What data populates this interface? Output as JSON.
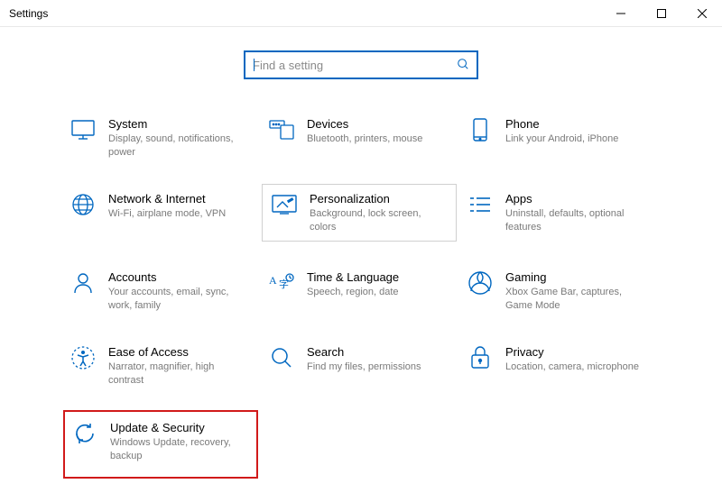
{
  "window": {
    "title": "Settings"
  },
  "search": {
    "placeholder": "Find a setting"
  },
  "tiles": {
    "system": {
      "title": "System",
      "desc": "Display, sound, notifications, power"
    },
    "devices": {
      "title": "Devices",
      "desc": "Bluetooth, printers, mouse"
    },
    "phone": {
      "title": "Phone",
      "desc": "Link your Android, iPhone"
    },
    "network": {
      "title": "Network & Internet",
      "desc": "Wi-Fi, airplane mode, VPN"
    },
    "personalize": {
      "title": "Personalization",
      "desc": "Background, lock screen, colors"
    },
    "apps": {
      "title": "Apps",
      "desc": "Uninstall, defaults, optional features"
    },
    "accounts": {
      "title": "Accounts",
      "desc": "Your accounts, email, sync, work, family"
    },
    "time": {
      "title": "Time & Language",
      "desc": "Speech, region, date"
    },
    "gaming": {
      "title": "Gaming",
      "desc": "Xbox Game Bar, captures, Game Mode"
    },
    "ease": {
      "title": "Ease of Access",
      "desc": "Narrator, magnifier, high contrast"
    },
    "searchTile": {
      "title": "Search",
      "desc": "Find my files, permissions"
    },
    "privacy": {
      "title": "Privacy",
      "desc": "Location, camera, microphone"
    },
    "update": {
      "title": "Update & Security",
      "desc": "Windows Update, recovery, backup"
    }
  }
}
